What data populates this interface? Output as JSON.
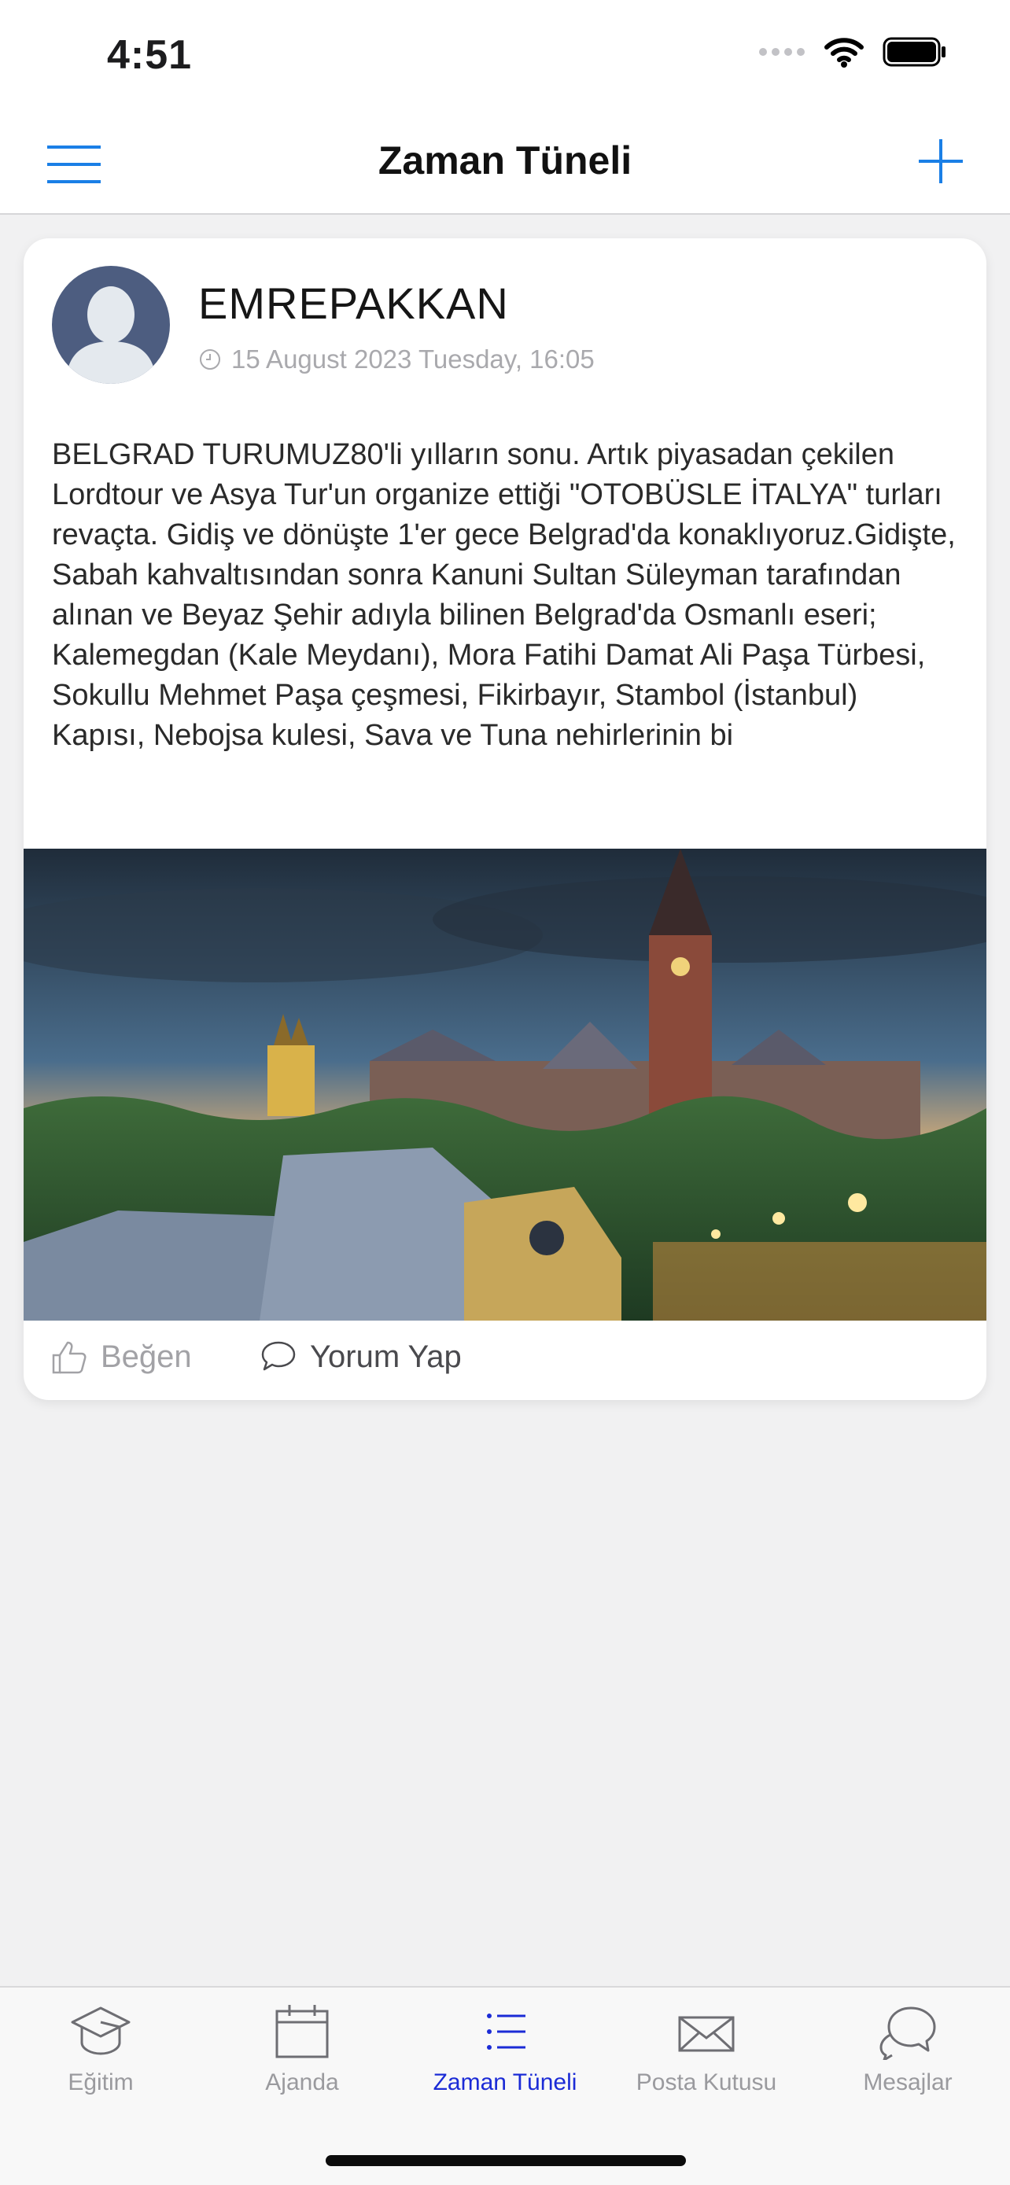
{
  "status_bar": {
    "time": "4:51"
  },
  "header": {
    "title": "Zaman Tüneli"
  },
  "post": {
    "author": "EMREPAKKAN",
    "date": "15 August 2023 Tuesday, 16:05",
    "text": "BELGRAD TURUMUZ80'li yılların sonu. Artık piyasadan çekilen Lordtour ve Asya Tur'un organize ettiği \"OTOBÜSLE İTALYA\" turları revaçta. Gidiş ve dönüşte 1'er gece Belgrad'da konaklıyoruz.Gidişte, Sabah kahvaltısından sonra Kanuni Sultan Süleyman tarafından alınan ve Beyaz Şehir adıyla bilinen Belgrad'da Osmanlı eseri; Kalemegdan (Kale Meydanı), Mora Fatihi Damat Ali Paşa Türbesi, Sokullu Mehmet Paşa çeşmesi, Fikirbayır, Stambol (İstanbul) Kapısı, Nebojsa kulesi, Sava ve Tuna nehirlerinin bi",
    "like_label": "Beğen",
    "comment_label": "Yorum Yap"
  },
  "tabs": [
    {
      "label": "Eğitim",
      "icon": "graduation-cap-icon",
      "active": false
    },
    {
      "label": "Ajanda",
      "icon": "calendar-icon",
      "active": false
    },
    {
      "label": "Zaman Tüneli",
      "icon": "list-icon",
      "active": true
    },
    {
      "label": "Posta Kutusu",
      "icon": "envelope-icon",
      "active": false
    },
    {
      "label": "Mesajlar",
      "icon": "chat-bubbles-icon",
      "active": false
    }
  ],
  "colors": {
    "accent": "#1a7fe6",
    "active_tab": "#1b2bd6",
    "inactive_tab": "#9a9a9e",
    "background": "#f1f1f2"
  }
}
